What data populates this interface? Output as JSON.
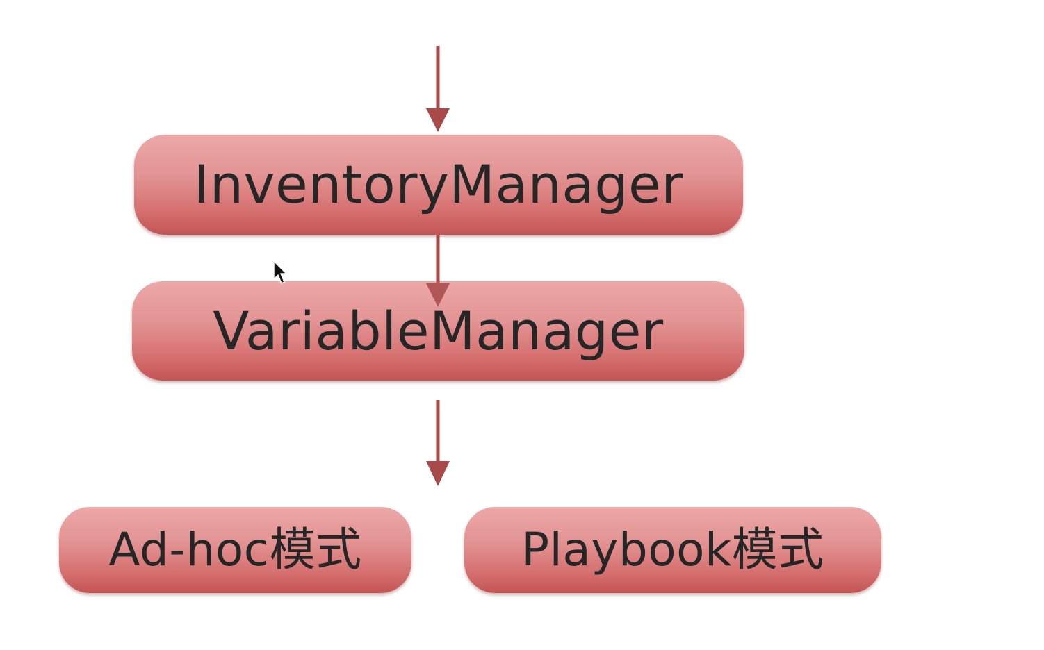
{
  "diagram": {
    "nodes": {
      "inventory_manager": "InventoryManager",
      "variable_manager": "VariableManager",
      "adhoc_mode": "Ad-hoc模式",
      "playbook_mode": "Playbook模式"
    },
    "colors": {
      "node_fill_top": "#eda8a8",
      "node_fill_bottom": "#c35454",
      "arrow": "#a84a4a",
      "text": "#262626",
      "background": "#ffffff"
    },
    "icons": {
      "cursor": "mouse-pointer-icon"
    }
  }
}
